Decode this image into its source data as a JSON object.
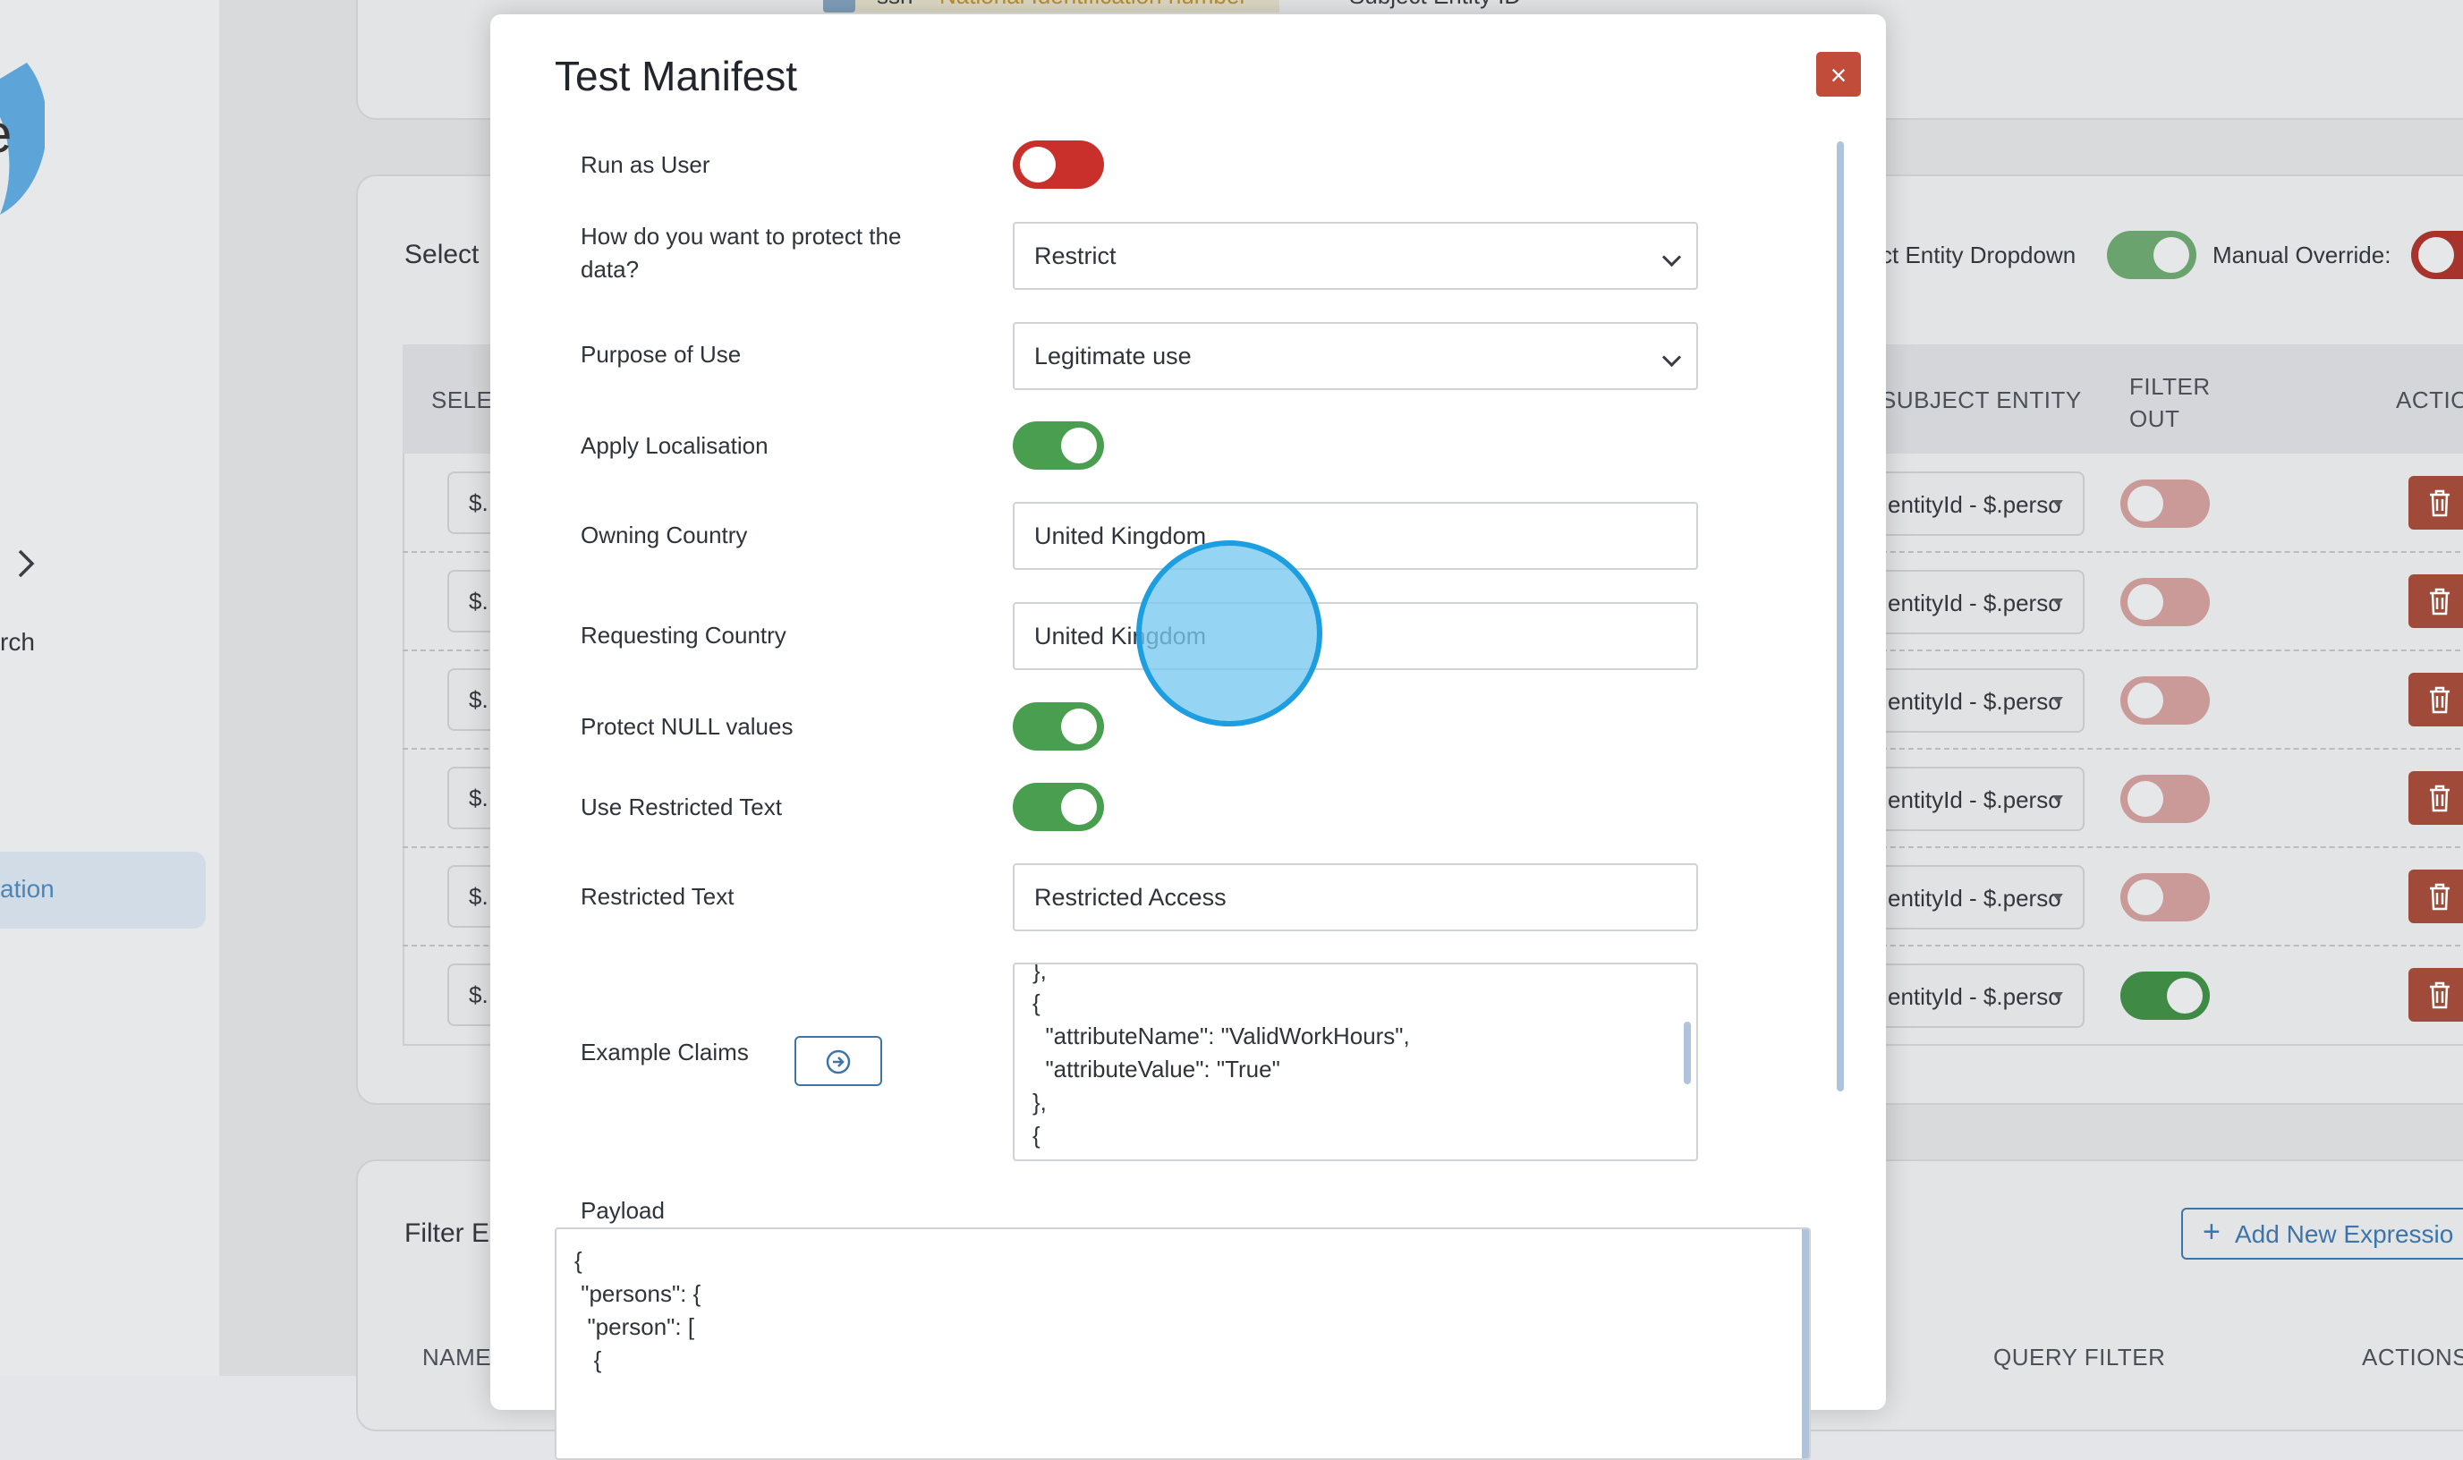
{
  "background": {
    "sidebar": {
      "item_partial_label": "rch",
      "active_item_partial_label": "ation"
    },
    "top_row": {
      "checked_field": "ssn",
      "highlighted_text": "National Identification number",
      "subject_label": "Subject Entity ID"
    },
    "select_section": {
      "heading_partial": "Select",
      "subject_dropdown_label_partial": "ct Entity Dropdown",
      "manual_override_label": "Manual Override:",
      "columns": [
        "SELE",
        "SUBJECT ENTITY",
        "FILTER OUT",
        "ACTIO"
      ],
      "rows": [
        {
          "selector": "$.",
          "entity": "entityId - $.perso",
          "filter_out": false
        },
        {
          "selector": "$.",
          "entity": "entityId - $.perso",
          "filter_out": false
        },
        {
          "selector": "$.",
          "entity": "entityId - $.perso",
          "filter_out": false
        },
        {
          "selector": "$.",
          "entity": "entityId - $.perso",
          "filter_out": false
        },
        {
          "selector": "$.",
          "entity": "entityId - $.perso",
          "filter_out": false
        },
        {
          "selector": "$.",
          "entity": "entityId - $.perso",
          "filter_out": true
        }
      ]
    },
    "filter_section": {
      "heading_partial": "Filter E",
      "add_button_label": "Add New Expressio",
      "columns": [
        "NAME",
        "QUERY FILTER",
        "ACTIONS"
      ]
    }
  },
  "modal": {
    "title": "Test Manifest",
    "close_label": "×",
    "run_as_user": {
      "label": "Run as User",
      "enabled": false
    },
    "protect_method": {
      "label": "How do you want to protect the data?",
      "value": "Restrict"
    },
    "purpose_of_use": {
      "label": "Purpose of Use",
      "value": "Legitimate use"
    },
    "apply_localisation": {
      "label": "Apply Localisation",
      "enabled": true
    },
    "owning_country": {
      "label": "Owning Country",
      "value": "United Kingdom"
    },
    "requesting_country": {
      "label": "Requesting Country",
      "value": "United Kingdom"
    },
    "protect_null": {
      "label": "Protect NULL values",
      "enabled": true
    },
    "use_restricted_text": {
      "label": "Use Restricted Text",
      "enabled": true
    },
    "restricted_text": {
      "label": "Restricted Text",
      "value": "Restricted Access"
    },
    "example_claims": {
      "label": "Example Claims",
      "lines": [
        "},",
        "{",
        "  \"attributeName\": \"ValidWorkHours\",",
        "  \"attributeValue\": \"True\"",
        "},",
        "{"
      ]
    },
    "payload": {
      "label": "Payload",
      "lines": [
        "{",
        " \"persons\": {",
        "  \"person\": [",
        "   {"
      ]
    }
  },
  "colors": {
    "toggle_on": "#4a9e4f",
    "toggle_off": "#c9302c",
    "close_button": "#c24c3a",
    "accent_blue": "#3d75a8",
    "click_indicator": "#1d9ee0"
  }
}
